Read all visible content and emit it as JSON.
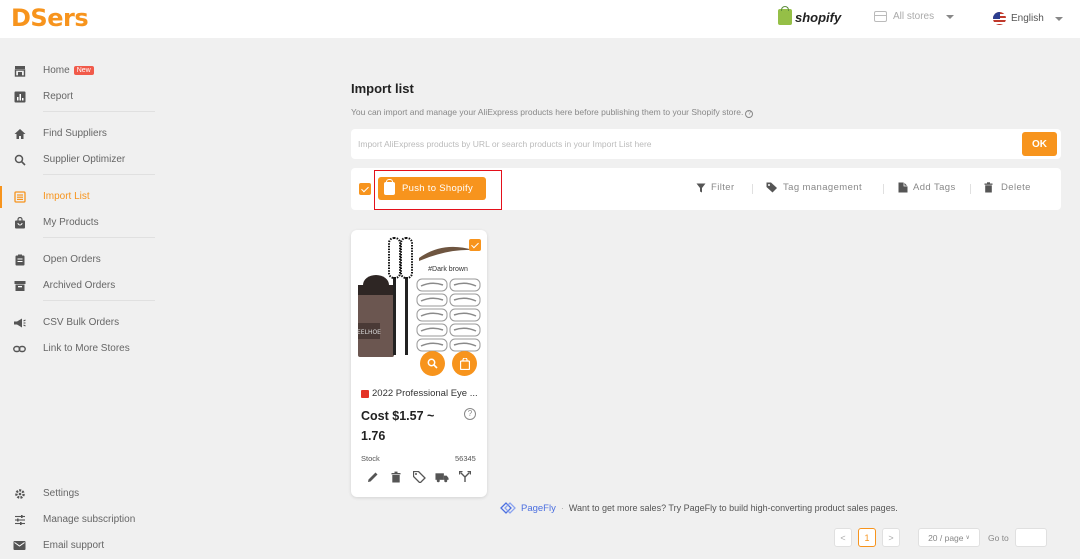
{
  "app": {
    "logo": "DSers"
  },
  "header": {
    "platform": "shopify",
    "stores_label": "All stores",
    "language": "English"
  },
  "sidebar": {
    "items": [
      {
        "label": "Home",
        "badge": "New",
        "icon": "store-icon"
      },
      {
        "label": "Report",
        "icon": "chart-icon"
      },
      {
        "label": "Find Suppliers",
        "icon": "home-icon"
      },
      {
        "label": "Supplier Optimizer",
        "icon": "search-icon"
      },
      {
        "label": "Import List",
        "icon": "list-icon",
        "active": true
      },
      {
        "label": "My Products",
        "icon": "bag-icon"
      },
      {
        "label": "Open Orders",
        "icon": "clipboard-icon"
      },
      {
        "label": "Archived Orders",
        "icon": "archive-icon"
      },
      {
        "label": "CSV Bulk Orders",
        "icon": "megaphone-icon"
      },
      {
        "label": "Link to More Stores",
        "icon": "link-icon"
      },
      {
        "label": "Settings",
        "icon": "gear-icon"
      },
      {
        "label": "Manage subscription",
        "icon": "sliders-icon"
      },
      {
        "label": "Email support",
        "icon": "mail-icon"
      }
    ]
  },
  "main": {
    "title": "Import list",
    "subtitle": "You can import and manage your AliExpress products here before publishing them to your Shopify store.",
    "search": {
      "placeholder": "Import AliExpress products by URL or search products in your Import List here",
      "button": "OK"
    },
    "toolbar": {
      "push_label": "Push to Shopify",
      "filter": "Filter",
      "tag_management": "Tag management",
      "add_tags": "Add Tags",
      "delete": "Delete"
    },
    "product": {
      "image_caption": "#Dark brown",
      "brand": "EELHOE",
      "title": "2022 Professional Eye ...",
      "cost": "Cost $1.57 ~ 1.76",
      "stock_label": "Stock",
      "stock_value": "56345"
    }
  },
  "footer": {
    "pagefly_brand": "PageFly",
    "pagefly_text": "Want to get more sales? Try PageFly to build high-converting product sales pages.",
    "pagination": {
      "prev": "<",
      "current_page": "1",
      "next": ">",
      "page_size": "20 / page",
      "goto_label": "Go to"
    }
  },
  "colors": {
    "accent": "#f7941d",
    "highlight_outline": "#e4101a",
    "new_badge": "#f15a4a"
  }
}
